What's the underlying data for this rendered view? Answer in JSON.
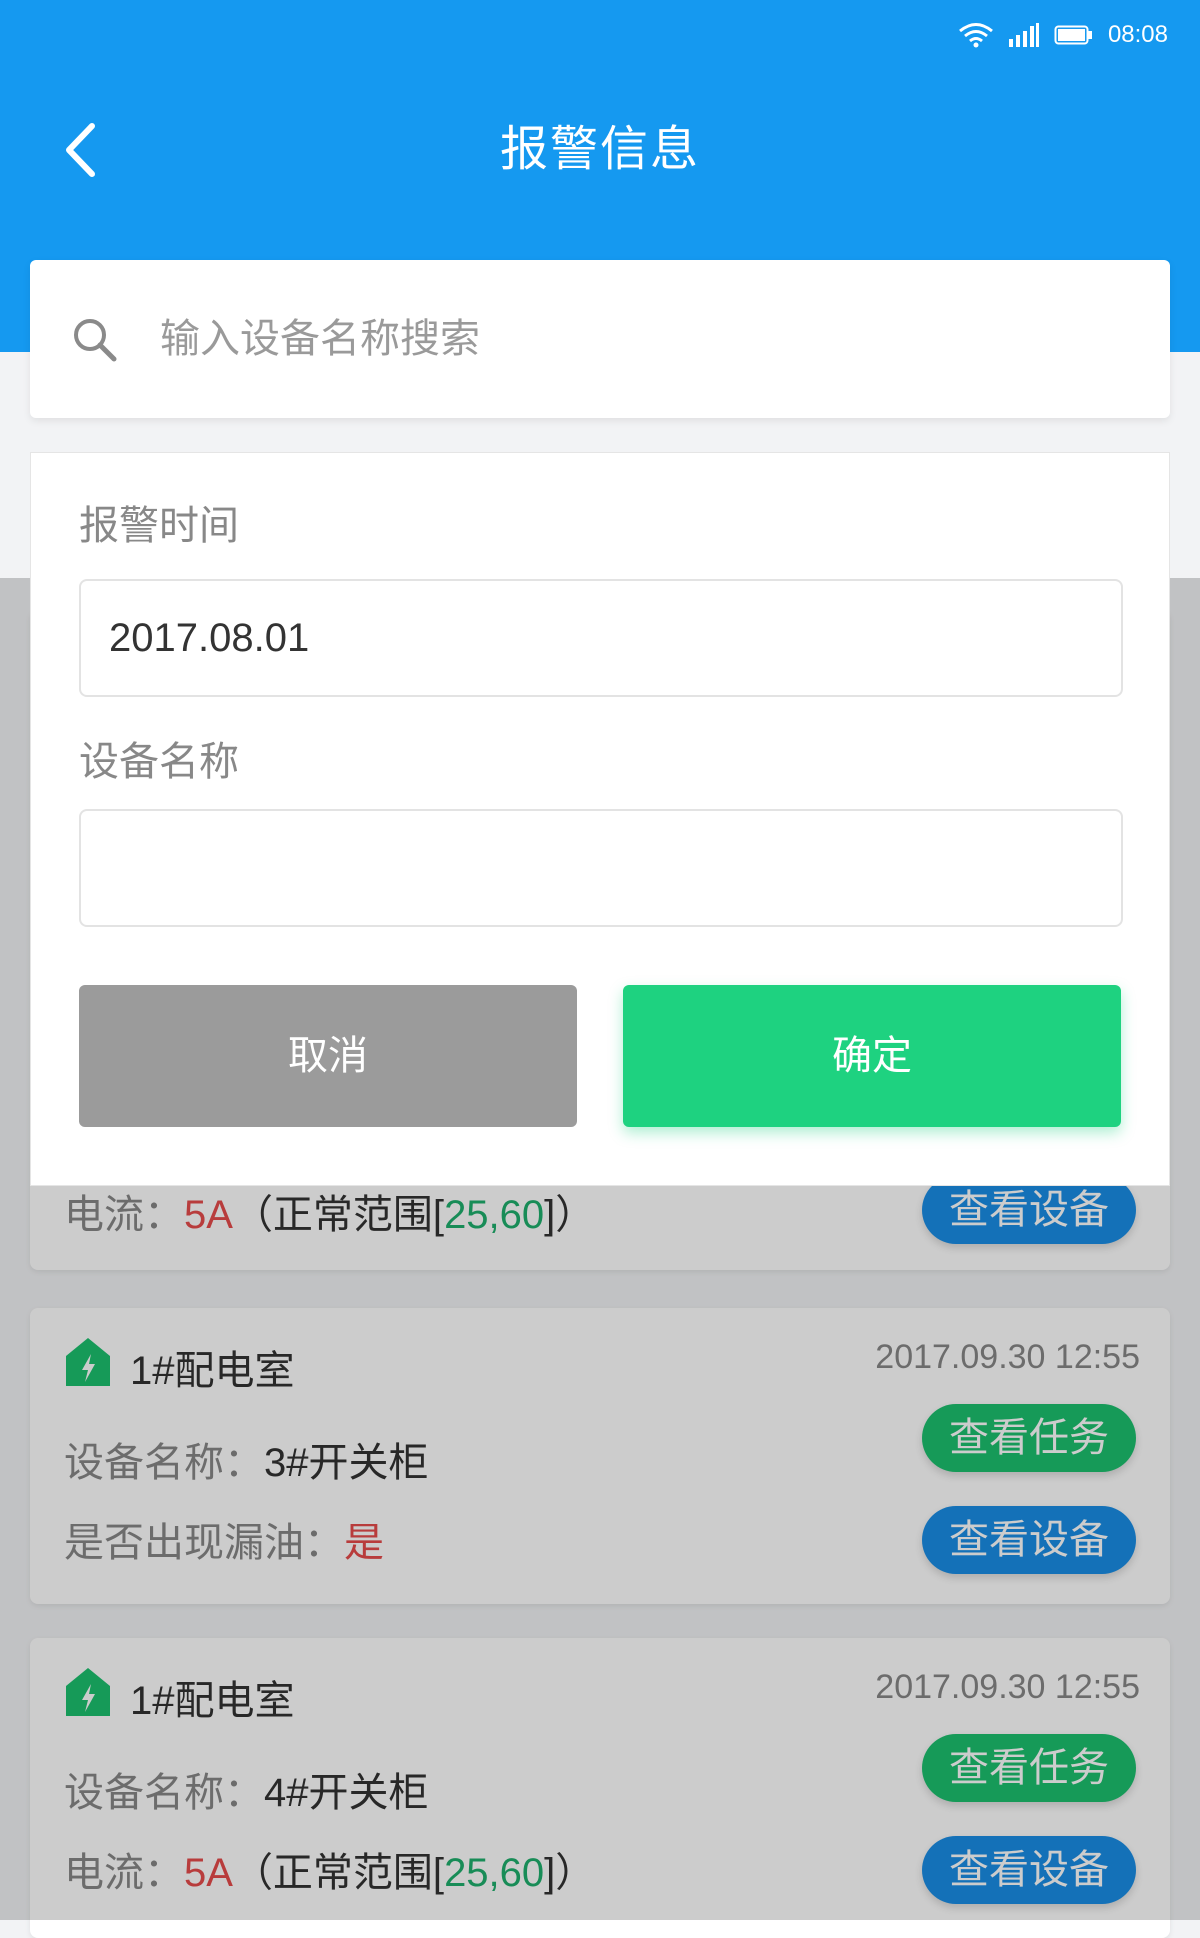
{
  "status_bar": {
    "time": "08:08"
  },
  "header": {
    "title": "报警信息"
  },
  "search": {
    "placeholder": "输入设备名称搜索"
  },
  "filter": {
    "time_label": "报警时间",
    "time_value": "2017.08.01",
    "device_label": "设备名称",
    "device_value": "",
    "cancel_label": "取消",
    "confirm_label": "确定"
  },
  "cards": [
    {
      "current_label": "电流：",
      "current_value": "5A",
      "range_prefix": "（正常范围[",
      "range_value": "25,60",
      "range_suffix": "]）",
      "view_device": "查看设备"
    },
    {
      "room": "1#配电室",
      "time": "2017.09.30 12:55",
      "device_label": "设备名称：",
      "device_value": "3#开关柜",
      "leak_label": "是否出现漏油：",
      "leak_value": "是",
      "view_task": "查看任务",
      "view_device": "查看设备"
    },
    {
      "room": "1#配电室",
      "time": "2017.09.30 12:55",
      "device_label": "设备名称：",
      "device_value": "4#开关柜",
      "current_label": "电流：",
      "current_value": "5A",
      "range_prefix": "（正常范围[",
      "range_value": "25,60",
      "range_suffix": "]）",
      "view_task": "查看任务",
      "view_device": "查看设备"
    }
  ],
  "colors": {
    "header": "#1599f0",
    "confirm": "#1ed280",
    "cancel": "#9b9b9b",
    "pill_green": "#1cc16f",
    "pill_blue": "#1a8ee6",
    "alert_red": "#e64b4b",
    "range_green": "#1fb06d"
  },
  "icons": {
    "back": "chevron-left-icon",
    "search": "search-icon",
    "room": "power-house-icon",
    "wifi": "wifi-icon",
    "signal": "signal-icon",
    "battery": "battery-icon"
  }
}
